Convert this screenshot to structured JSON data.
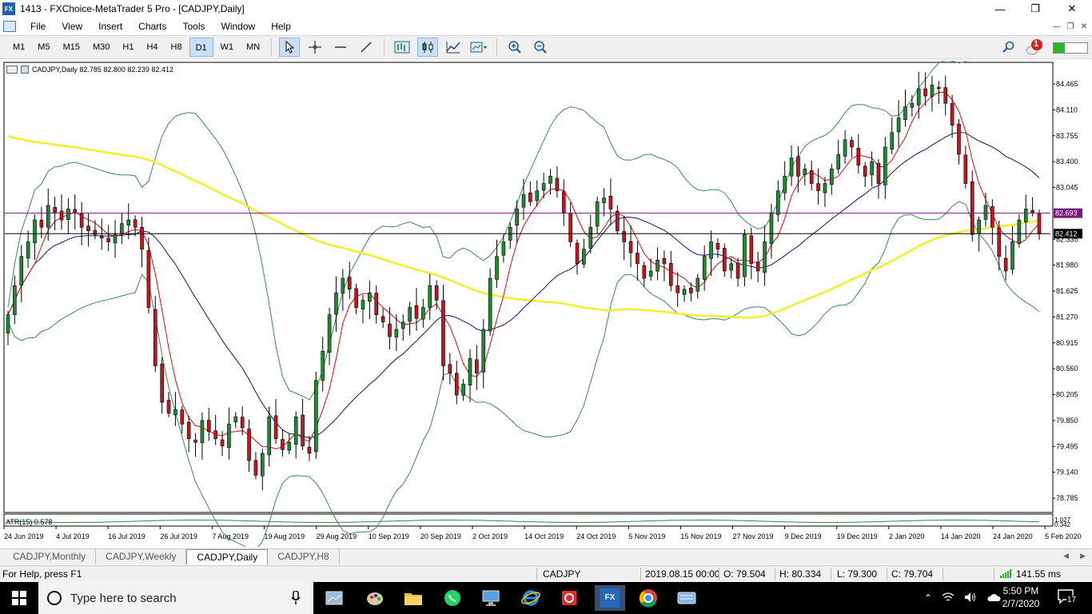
{
  "window": {
    "title": "1413 - FXChoice-MetaTrader 5 Pro - [CADJPY,Daily]",
    "app_icon": "FX",
    "controls": {
      "minimize": "—",
      "restore": "❐",
      "close": "✕"
    }
  },
  "menu": [
    "File",
    "View",
    "Insert",
    "Charts",
    "Tools",
    "Window",
    "Help"
  ],
  "toolbar": {
    "timeframes": [
      "M1",
      "M5",
      "M15",
      "M30",
      "H1",
      "H4",
      "H8",
      "D1",
      "W1",
      "MN"
    ],
    "active_timeframe": "D1",
    "notification_count": "1"
  },
  "chart": {
    "info": "CADJPY,Daily  82.785 82.800 82.239 82.412",
    "atr_label": "ATR(15) 0.578",
    "current_price": "82.412",
    "level_price": "82.693",
    "price_ticks": [
      "84.465",
      "84.110",
      "83.755",
      "83.400",
      "83.045",
      "82.335",
      "81.980",
      "81.625",
      "81.270",
      "80.915",
      "80.560",
      "80.205",
      "79.850",
      "79.495",
      "79.140",
      "78.785"
    ],
    "atr_ticks": [
      "1.027",
      "0.342"
    ],
    "date_ticks": [
      "24 Jun 2019",
      "4 Jul 2019",
      "16 Jul 2019",
      "26 Jul 2019",
      "7 Aug 2019",
      "19 Aug 2019",
      "29 Aug 2019",
      "10 Sep 2019",
      "20 Sep 2019",
      "2 Oct 2019",
      "14 Oct 2019",
      "24 Oct 2019",
      "5 Nov 2019",
      "15 Nov 2019",
      "27 Nov 2019",
      "9 Dec 2019",
      "19 Dec 2019",
      "2 Jan 2020",
      "14 Jan 2020",
      "24 Jan 2020",
      "5 Feb 2020"
    ],
    "colors": {
      "bull": "#1e8b2e",
      "bear": "#c4161c",
      "ma_yellow": "#f2ee2a",
      "ma_red": "#d01010",
      "ma_blue": "#101080",
      "bands": "#3a8a55",
      "level": "#7a1a7a"
    }
  },
  "chart_data": {
    "type": "candlestick",
    "symbol": "CADJPY",
    "ylim": [
      78.6,
      84.75
    ],
    "close": [
      81.3,
      81.7,
      82.1,
      82.3,
      82.6,
      82.5,
      82.8,
      82.7,
      82.6,
      82.75,
      82.7,
      82.5,
      82.45,
      82.4,
      82.35,
      82.3,
      82.4,
      82.55,
      82.6,
      82.5,
      82.2,
      81.4,
      80.6,
      80.1,
      79.95,
      80.0,
      79.8,
      79.6,
      79.55,
      79.85,
      79.7,
      79.6,
      79.5,
      79.8,
      79.9,
      79.75,
      79.3,
      79.1,
      79.4,
      79.9,
      79.6,
      79.45,
      79.55,
      79.9,
      79.5,
      79.4,
      80.4,
      80.8,
      81.3,
      81.6,
      81.8,
      81.65,
      81.4,
      81.5,
      81.6,
      81.3,
      81.2,
      81.0,
      81.1,
      81.2,
      81.4,
      81.25,
      81.4,
      81.7,
      81.5,
      80.6,
      80.5,
      80.2,
      80.35,
      80.7,
      80.5,
      81.1,
      81.8,
      82.1,
      82.3,
      82.5,
      82.75,
      82.95,
      82.85,
      83.0,
      83.1,
      83.2,
      83.0,
      82.7,
      82.3,
      82.0,
      82.2,
      82.5,
      82.85,
      82.9,
      82.75,
      82.45,
      82.3,
      82.15,
      82.0,
      81.8,
      81.9,
      82.05,
      82.0,
      81.7,
      81.6,
      81.65,
      81.6,
      81.8,
      82.1,
      82.3,
      82.2,
      81.9,
      82.0,
      81.8,
      82.4,
      82.0,
      81.9,
      82.3,
      82.7,
      83.0,
      83.2,
      83.45,
      83.2,
      83.3,
      83.1,
      83.0,
      83.1,
      83.3,
      83.5,
      83.7,
      83.6,
      83.35,
      83.2,
      83.4,
      83.1,
      83.6,
      83.8,
      84.0,
      84.15,
      84.2,
      84.4,
      84.3,
      84.45,
      84.4,
      84.2,
      83.9,
      83.5,
      83.1,
      82.4,
      82.6,
      82.8,
      82.5,
      82.1,
      81.9,
      82.3,
      82.6,
      82.75,
      82.7,
      82.41
    ]
  },
  "tabs": [
    "CADJPY,Monthly",
    "CADJPY,Weekly",
    "CADJPY,Daily",
    "CADJPY,H8"
  ],
  "active_tab": "CADJPY,Daily",
  "status": {
    "help": "For Help, press F1",
    "symbol": "CADJPY",
    "datetime": "2019.08.15 00:00",
    "open": "O: 79.504",
    "high": "H: 80.334",
    "low": "L: 79.300",
    "close": "C: 79.704",
    "ping": "141.55 ms"
  },
  "taskbar": {
    "search_placeholder": "Type here to search",
    "time": "5:50 PM",
    "date": "2/7/2020",
    "notifications": "17"
  }
}
